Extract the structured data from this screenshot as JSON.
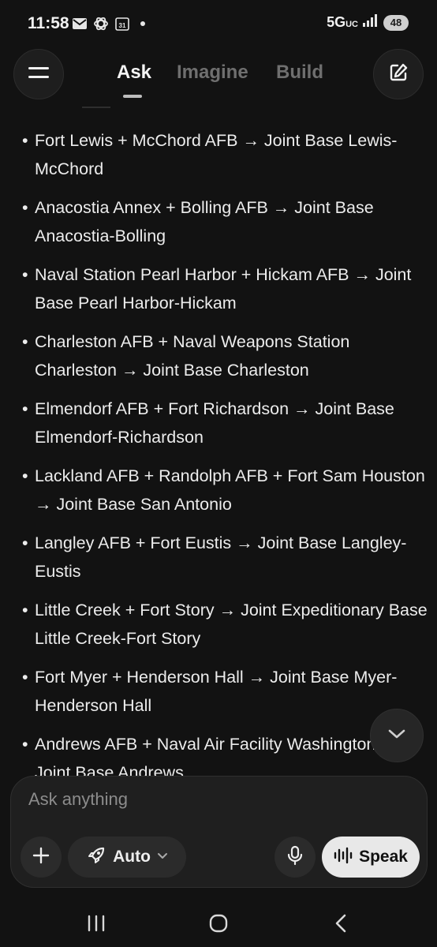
{
  "status_bar": {
    "time": "11:58",
    "network": "5G",
    "network_sub": "UC",
    "battery": "48",
    "calendar_day": "31"
  },
  "header": {
    "tabs": [
      {
        "label": "Ask",
        "active": true
      },
      {
        "label": "Imagine",
        "active": false
      },
      {
        "label": "Build",
        "active": false
      }
    ]
  },
  "content": {
    "items": [
      "Fort Lewis + McChord AFB → Joint Base Lewis-McChord",
      "Anacostia Annex + Bolling AFB → Joint Base Anacostia-Bolling",
      "Naval Station Pearl Harbor + Hickam AFB → Joint Base Pearl Harbor-Hickam",
      "Charleston AFB + Naval Weapons Station Charleston → Joint Base Charleston",
      "Elmendorf AFB + Fort Richardson → Joint Base Elmendorf-Richardson",
      "Lackland AFB + Randolph AFB + Fort Sam Houston → Joint Base San Antonio",
      "Langley AFB + Fort Eustis → Joint Base Langley-Eustis",
      "Little Creek + Fort Story → Joint Expeditionary Base Little Creek-Fort Story",
      "Fort Myer + Henderson Hall → Joint Base Myer-Henderson Hall",
      "Andrews AFB + Naval Air Facility Washington → Joint Base Andrews"
    ]
  },
  "composer": {
    "placeholder": "Ask anything",
    "mode_label": "Auto",
    "speak_label": "Speak"
  },
  "colors": {
    "background": "#121212",
    "text": "#ececec",
    "muted_tab": "#6f6f6f",
    "speak_bg": "#e8e8e8"
  }
}
